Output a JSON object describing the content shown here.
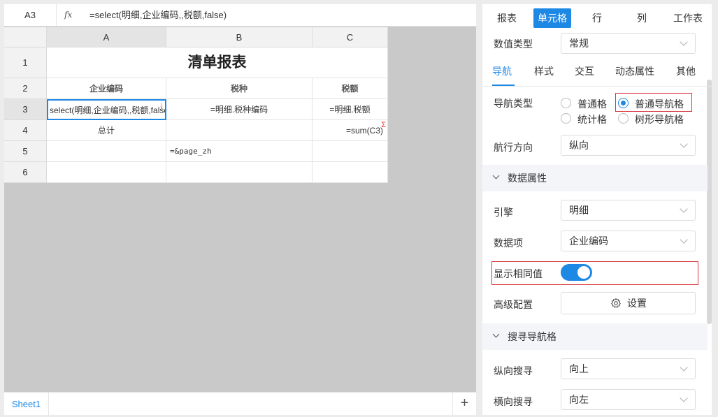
{
  "formula_bar": {
    "cell_ref": "A3",
    "fx_symbol": "fx",
    "formula": "=select(明细,企业编码,,税额,false)"
  },
  "grid": {
    "columns": [
      "A",
      "B",
      "C"
    ],
    "rows": [
      "1",
      "2",
      "3",
      "4",
      "5",
      "6"
    ],
    "title": "清单报表",
    "header": {
      "a": "企业编码",
      "b": "税种",
      "c": "税额"
    },
    "row3": {
      "a": "select(明细,企业编码,,税额,false)",
      "b": "=明细.税种编码",
      "c": "=明细.税额"
    },
    "row4": {
      "a": "总计",
      "b": "",
      "c": "=sum(C3)"
    },
    "row5": {
      "a": "",
      "b": "=&page_zh",
      "c": ""
    },
    "expand_down_marker": "↓",
    "sum_marker": "Σ"
  },
  "sheet_bar": {
    "sheet_name": "Sheet1",
    "add_symbol": "+"
  },
  "panel": {
    "tabs": [
      "报表",
      "单元格",
      "行",
      "列",
      "工作表"
    ],
    "active_tab": "单元格",
    "value_type": {
      "label": "数值类型",
      "value": "常规"
    },
    "subtabs": [
      "导航",
      "样式",
      "交互",
      "动态属性",
      "其他"
    ],
    "active_subtab": "导航",
    "nav_type": {
      "label": "导航类型",
      "options": [
        "普通格",
        "普通导航格",
        "统计格",
        "树形导航格"
      ],
      "selected": "普通导航格"
    },
    "direction": {
      "label": "航行方向",
      "value": "纵向"
    },
    "data_props": {
      "title": "数据属性",
      "engine": {
        "label": "引擎",
        "value": "明细"
      },
      "item": {
        "label": "数据项",
        "value": "企业编码"
      },
      "show_same": {
        "label": "显示相同值",
        "on": true
      },
      "advanced": {
        "label": "高级配置",
        "button": "设置"
      }
    },
    "search_nav": {
      "title": "搜寻导航格",
      "vertical": {
        "label": "纵向搜寻",
        "value": "向上"
      },
      "horizontal": {
        "label": "横向搜寻",
        "value": "向左"
      }
    },
    "colors": {
      "accent": "#1e88e5",
      "highlight_border": "#d9363e"
    }
  }
}
